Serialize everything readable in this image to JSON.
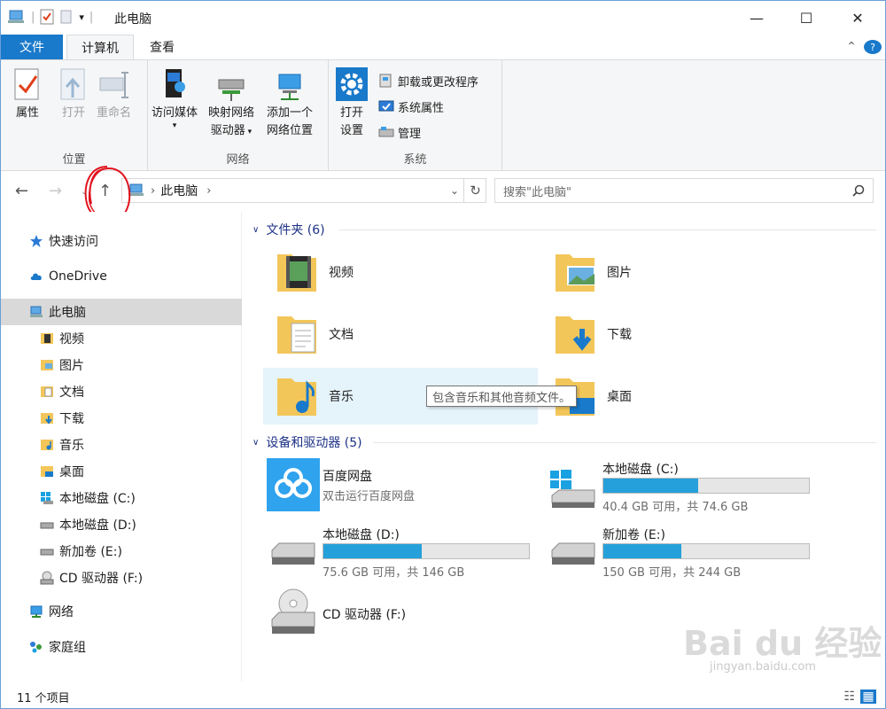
{
  "window": {
    "title": "此电脑",
    "minimize": "—",
    "maximize": "☐",
    "close": "✕"
  },
  "tabs": {
    "file": "文件",
    "computer": "计算机",
    "view": "查看",
    "help": "?"
  },
  "ribbon": {
    "location": {
      "label": "位置",
      "properties": "属性",
      "open": "打开",
      "rename": "重命名"
    },
    "network": {
      "label": "网络",
      "access_media": "访问媒体",
      "map_drive_1": "映射网络",
      "map_drive_2": "驱动器",
      "add_location_1": "添加一个",
      "add_location_2": "网络位置"
    },
    "system": {
      "label": "系统",
      "open_settings_1": "打开",
      "open_settings_2": "设置",
      "uninstall": "卸载或更改程序",
      "system_properties": "系统属性",
      "manage": "管理"
    }
  },
  "address": {
    "path": "此电脑",
    "search_placeholder": "搜索\"此电脑\""
  },
  "nav": {
    "quick_access": "快速访问",
    "onedrive": "OneDrive",
    "this_pc": "此电脑",
    "videos": "视频",
    "pictures": "图片",
    "documents": "文档",
    "downloads": "下载",
    "music": "音乐",
    "desktop": "桌面",
    "drive_c": "本地磁盘 (C:)",
    "drive_d": "本地磁盘 (D:)",
    "drive_e": "新加卷 (E:)",
    "drive_f": "CD 驱动器 (F:)",
    "network": "网络",
    "homegroup": "家庭组"
  },
  "folders": {
    "header": "文件夹 (6)",
    "videos": "视频",
    "pictures": "图片",
    "documents": "文档",
    "downloads": "下载",
    "music": "音乐",
    "desktop": "桌面",
    "tooltip": "包含音乐和其他音频文件。"
  },
  "devices": {
    "header": "设备和驱动器 (5)",
    "baidu_name": "百度网盘",
    "baidu_sub": "双击运行百度网盘",
    "drive_c": {
      "name": "本地磁盘 (C:)",
      "info": "40.4 GB 可用，共 74.6 GB",
      "used_fraction": 0.46
    },
    "drive_d": {
      "name": "本地磁盘 (D:)",
      "info": "75.6 GB 可用，共 146 GB",
      "used_fraction": 0.48
    },
    "drive_e": {
      "name": "新加卷 (E:)",
      "info": "150 GB 可用，共 244 GB",
      "used_fraction": 0.38
    },
    "drive_f": {
      "name": "CD 驱动器 (F:)"
    }
  },
  "status": {
    "count": "11 个项目"
  },
  "watermark": {
    "brand": "Bai du 经验",
    "url": "jingyan.baidu.com"
  },
  "colors": {
    "accent": "#1979ca",
    "drive_fill": "#26a0da",
    "annotation": "#e0141e"
  }
}
